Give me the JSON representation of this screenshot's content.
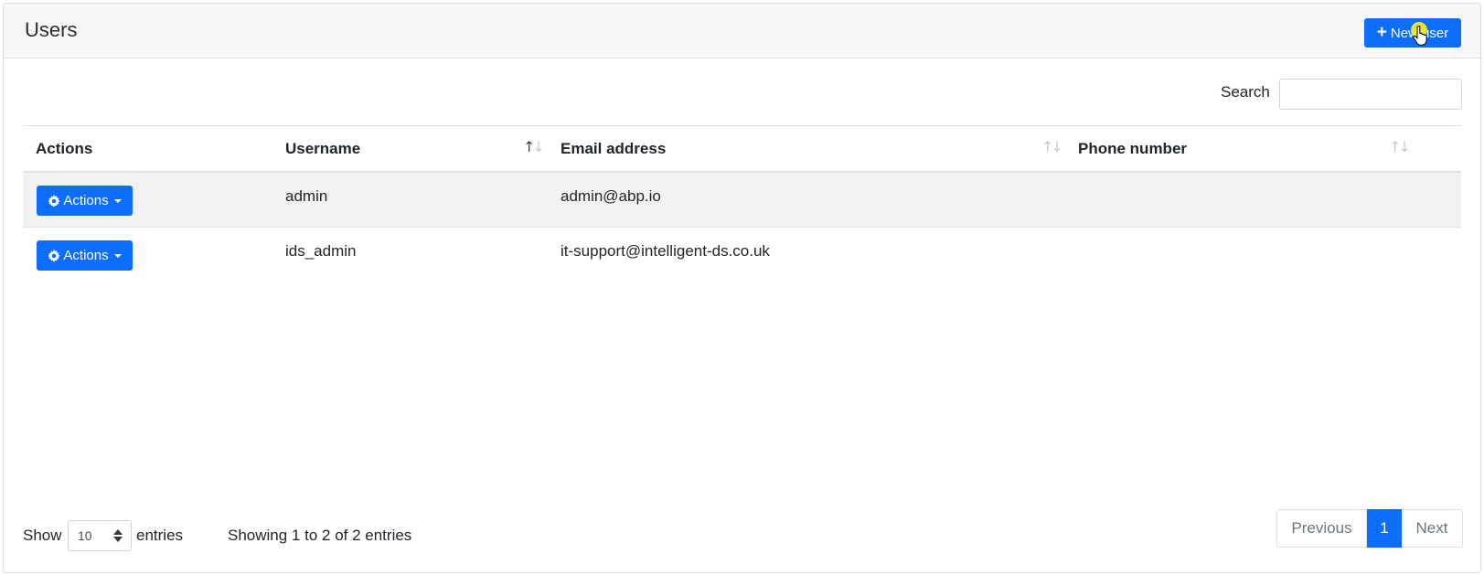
{
  "header": {
    "title": "Users",
    "new_user_label": "New user"
  },
  "search": {
    "label": "Search",
    "value": "",
    "placeholder": ""
  },
  "table": {
    "columns": [
      "Actions",
      "Username",
      "Email address",
      "Phone number"
    ],
    "rows": [
      {
        "actions_label": "Actions",
        "username": "admin",
        "email": "admin@abp.io",
        "phone": ""
      },
      {
        "actions_label": "Actions",
        "username": "ids_admin",
        "email": "it-support@intelligent-ds.co.uk",
        "phone": ""
      }
    ],
    "sorted_column": "Username",
    "sort_direction": "ascending"
  },
  "footer": {
    "show_label": "Show",
    "page_length": "10",
    "entries_label": "entries",
    "info": "Showing 1 to 2 of 2 entries"
  },
  "pagination": {
    "previous_label": "Previous",
    "current_page": "1",
    "next_label": "Next"
  },
  "colors": {
    "primary": "#0d6efd",
    "header_bg": "#f7f7f7",
    "striped_row": "#f2f2f2",
    "cursor_highlight": "#f1e928"
  },
  "icons": [
    "plus-icon",
    "gear-icon",
    "caret-down-icon",
    "sort-icon",
    "pointer-cursor-icon"
  ]
}
